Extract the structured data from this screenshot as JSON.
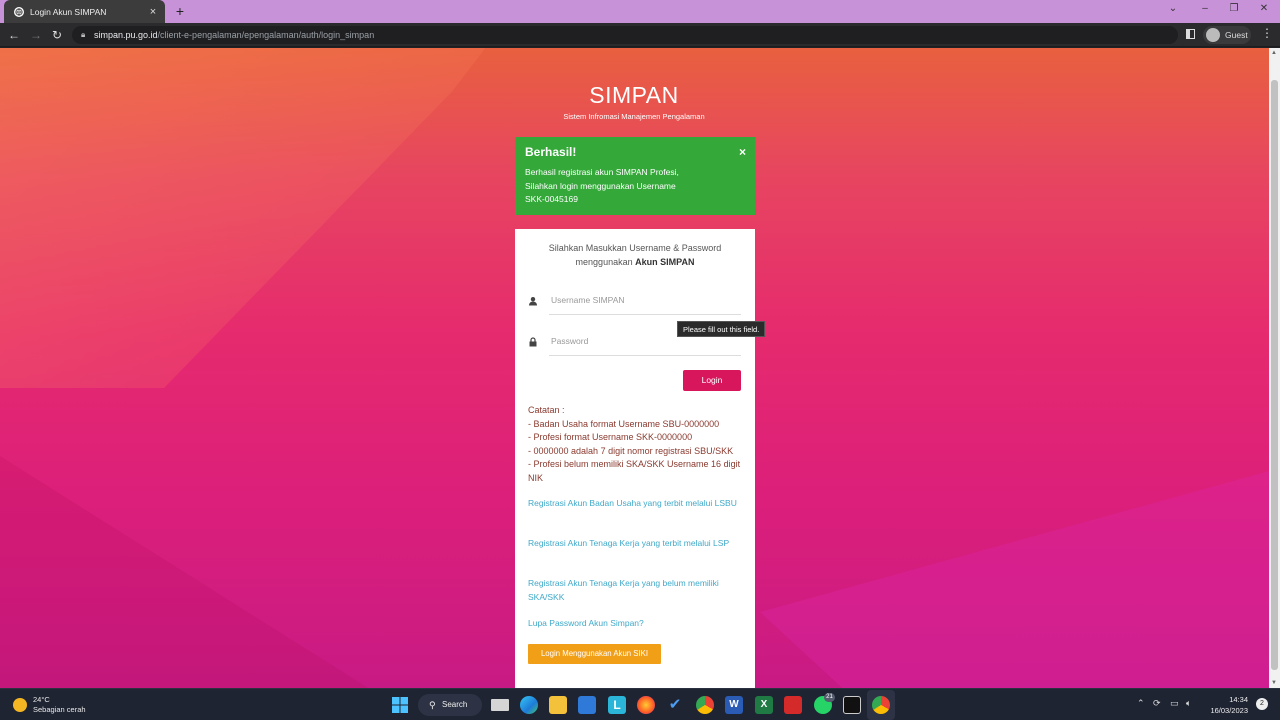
{
  "browser": {
    "tab_title": "Login Akun SIMPAN",
    "tab_close": "×",
    "new_tab": "+",
    "url_host": "simpan.pu.go.id",
    "url_path": "/client-e-pengalaman/epengalaman/auth/login_simpan",
    "profile_label": "Guest"
  },
  "page": {
    "app_title": "SIMPAN",
    "app_subtitle": "Sistem Infromasi Manajemen Pengalaman",
    "alert": {
      "title": "Berhasil!",
      "close": "×",
      "line1": "Berhasil registrasi akun SIMPAN Profesi,",
      "line2": "Silahkan login menggunakan Username",
      "line3": "SKK-0045169",
      "color": "#34a93a"
    },
    "form": {
      "intro_line1": "Silahkan Masukkan Username & Password",
      "intro_prefix": "menggunakan",
      "intro_bold": "Akun SIMPAN",
      "username_placeholder": "Username SIMPAN",
      "password_placeholder": "Password",
      "tooltip": "Please fill out this field.",
      "login_button": "Login",
      "login_color": "#d8165c"
    },
    "notes": [
      "Catatan :",
      "- Badan Usaha format Username SBU-0000000",
      "- Profesi format Username SKK-0000000",
      "- 0000000 adalah 7 digit nomor registrasi SBU/SKK",
      "- Profesi belum memiliki SKA/SKK Username 16 digit NIK"
    ],
    "links": {
      "reg_badan_usaha": "Registrasi Akun Badan Usaha yang terbit melalui LSBU",
      "reg_tenaga_kerja_lsp": "Registrasi Akun Tenaga Kerja yang terbit melalui LSP",
      "reg_tenaga_kerja_no_ska": "Registrasi Akun Tenaga Kerja yang belum memiliki SKA/SKK",
      "forgot_password": "Lupa Password Akun Simpan?"
    },
    "siki_button": "Login Menggunakan Akun SIKI",
    "siki_color": "#f29f18"
  },
  "taskbar": {
    "weather_temp": "24°C",
    "weather_desc": "Sebagian cerah",
    "search_label": "Search",
    "time": "14:34",
    "date": "16/03/2023",
    "badge_whatsapp": "21",
    "notification_count": "2"
  }
}
